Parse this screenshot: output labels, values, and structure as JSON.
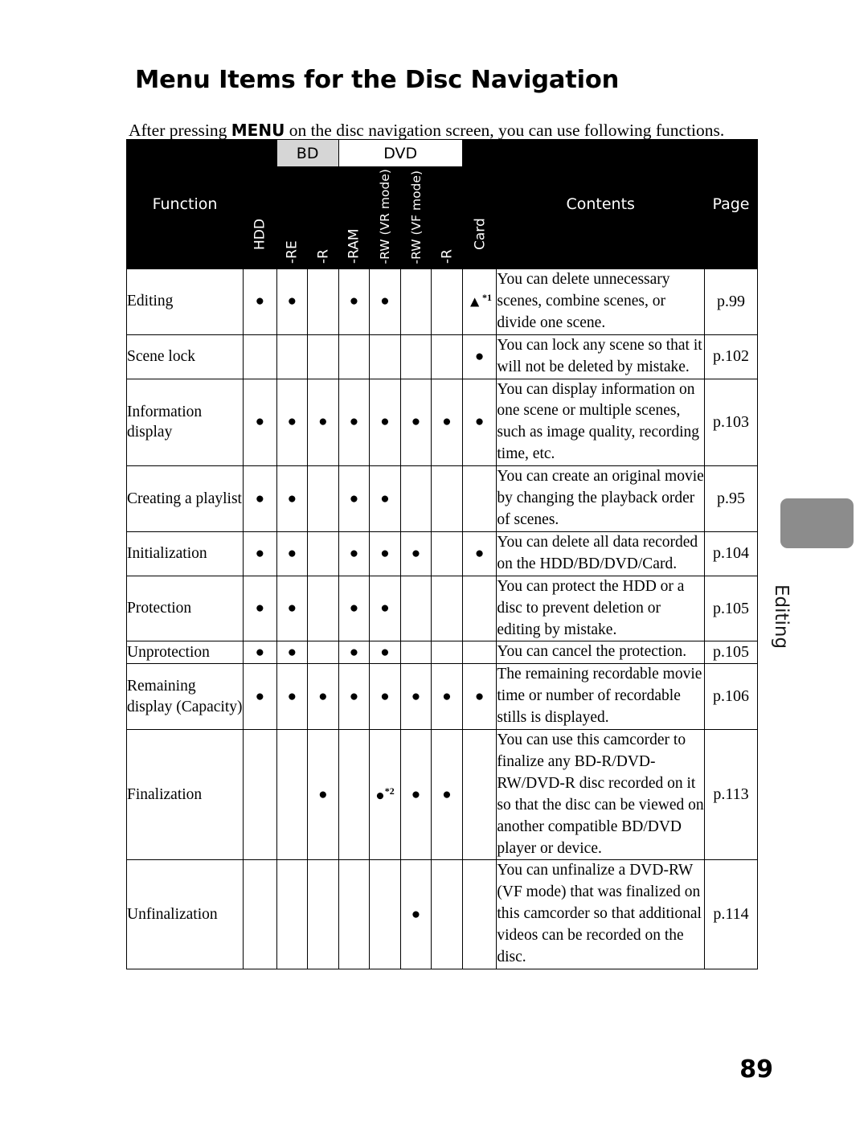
{
  "document": {
    "title": "Menu Items for the Disc Navigation",
    "intro_before": "After pressing ",
    "intro_keyword": "MENU",
    "intro_after": " on the disc navigation screen, you can use following functions.",
    "folio": "89",
    "side_tab_label": "Editing"
  },
  "table": {
    "header": {
      "function": "Function",
      "groups": [
        {
          "label": "BD",
          "span": 2,
          "bg": "#d6d6d6"
        },
        {
          "label": "DVD",
          "span": 4,
          "bg": "#ffffff"
        }
      ],
      "media_columns": [
        "HDD",
        "-RE",
        "-R",
        "-RAM",
        "-RW (VR mode)",
        "-RW (VF mode)",
        "-R",
        "Card"
      ],
      "contents": "Contents",
      "page": "Page"
    },
    "symbols": {
      "dot": "●",
      "triangle": "▲",
      "note1": "*1",
      "note2": "*2"
    },
    "rows": [
      {
        "function": "Editing",
        "marks": [
          "dot",
          "dot",
          "",
          "dot",
          "dot",
          "",
          "",
          "tri*1"
        ],
        "contents": "You can delete unnecessary scenes, combine scenes, or divide one scene.",
        "page": "p.99"
      },
      {
        "function": "Scene lock",
        "marks": [
          "",
          "",
          "",
          "",
          "",
          "",
          "",
          "dot"
        ],
        "contents": "You can lock any scene so that it will not be deleted by mistake.",
        "page": "p.102"
      },
      {
        "function": "Information display",
        "marks": [
          "dot",
          "dot",
          "dot",
          "dot",
          "dot",
          "dot",
          "dot",
          "dot"
        ],
        "contents": "You can display information on one scene or multiple scenes, such as image quality, recording time, etc.",
        "page": "p.103"
      },
      {
        "function": "Creating a playlist",
        "marks": [
          "dot",
          "dot",
          "",
          "dot",
          "dot",
          "",
          "",
          ""
        ],
        "contents": "You can create an original movie by changing the playback order of scenes.",
        "page": "p.95"
      },
      {
        "function": "Initialization",
        "marks": [
          "dot",
          "dot",
          "",
          "dot",
          "dot",
          "dot",
          "",
          "dot"
        ],
        "contents": "You can delete all data recorded on the HDD/BD/DVD/Card.",
        "page": "p.104"
      },
      {
        "function": "Protection",
        "marks": [
          "dot",
          "dot",
          "",
          "dot",
          "dot",
          "",
          "",
          ""
        ],
        "contents": "You can protect the HDD or a disc to prevent deletion or editing by mistake.",
        "page": "p.105"
      },
      {
        "function": "Unprotection",
        "marks": [
          "dot",
          "dot",
          "",
          "dot",
          "dot",
          "",
          "",
          ""
        ],
        "contents": "You can cancel the protection.",
        "page": "p.105"
      },
      {
        "function": "Remaining display (Capacity)",
        "marks": [
          "dot",
          "dot",
          "dot",
          "dot",
          "dot",
          "dot",
          "dot",
          "dot"
        ],
        "contents": "The remaining recordable movie time or number of recordable stills is displayed.",
        "page": "p.106"
      },
      {
        "function": "Finalization",
        "marks": [
          "",
          "",
          "dot",
          "",
          "dot*2",
          "dot",
          "dot",
          ""
        ],
        "contents": "You can use this camcorder to finalize any BD-R/DVD-RW/DVD-R disc recorded on it so that the disc can be viewed on another compatible BD/DVD player or device.",
        "page": "p.113"
      },
      {
        "function": "Unfinalization",
        "marks": [
          "",
          "",
          "",
          "",
          "",
          "dot",
          "",
          ""
        ],
        "contents": "You can unfinalize a DVD-RW (VF mode) that was finalized on this camcorder so that additional videos can be recorded on the disc.",
        "page": "p.114"
      }
    ]
  }
}
